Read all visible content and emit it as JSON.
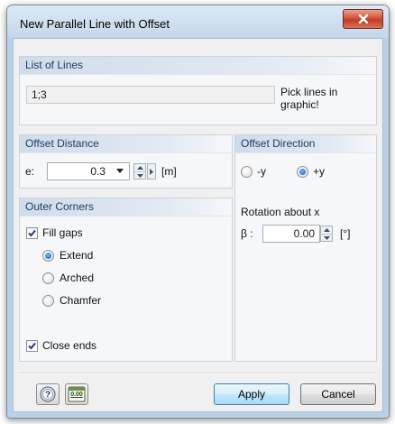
{
  "window": {
    "title": "New Parallel Line with Offset"
  },
  "list_of_lines": {
    "header": "List of Lines",
    "value": "1;3",
    "pick_hint": "Pick lines in graphic!"
  },
  "offset_distance": {
    "header": "Offset Distance",
    "label": "e:",
    "value": "0.3",
    "unit": "[m]"
  },
  "offset_direction": {
    "header": "Offset Direction",
    "options": [
      {
        "label": "-y",
        "selected": false
      },
      {
        "label": "+y",
        "selected": true
      }
    ]
  },
  "rotation": {
    "title": "Rotation about x",
    "label": "β :",
    "value": "0.00",
    "unit": "[°]"
  },
  "outer_corners": {
    "header": "Outer Corners",
    "fill_gaps_label": "Fill gaps",
    "fill_gaps_checked": true,
    "options": [
      {
        "label": "Extend",
        "selected": true
      },
      {
        "label": "Arched",
        "selected": false
      },
      {
        "label": "Chamfer",
        "selected": false
      }
    ],
    "close_ends_label": "Close ends",
    "close_ends_checked": true
  },
  "footer": {
    "help_icon": "help-icon",
    "units_icon": "units-icon",
    "units_icon_text": "0.00",
    "apply_label": "Apply",
    "cancel_label": "Cancel"
  },
  "colors": {
    "header_text": "#1e3c64",
    "close_button": "#c23a20",
    "default_button_border": "#3c7fb1"
  }
}
